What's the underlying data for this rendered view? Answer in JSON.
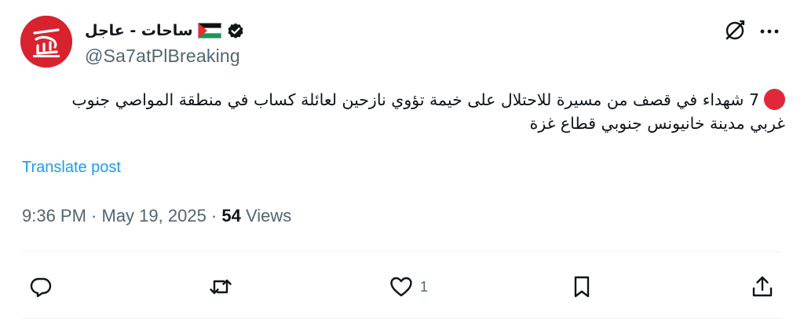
{
  "author": {
    "display_name": "ساحات - عاجل",
    "handle": "@Sa7atPlBreaking",
    "avatar_icon": "sa7at-logo",
    "flag_icon": "palestine-flag",
    "verified_icon": "verified-badge"
  },
  "header_actions": {
    "grok_icon": "grok-icon",
    "more_icon": "more-icon"
  },
  "tweet": {
    "bullet_icon": "red-circle",
    "text": "7 شهداء في قصف من مسيرة للاحتلال على خيمة تؤوي نازحين لعائلة كساب في منطقة المواصي جنوب غربي مدينة خانيونس جنوبي قطاع غزة",
    "translate_label": "Translate post"
  },
  "meta": {
    "time": "9:36 PM",
    "separator": " · ",
    "date": "May 19, 2025",
    "separator2": " · ",
    "views_count": "54",
    "views_label": " Views"
  },
  "actions": {
    "reply_count": "",
    "repost_count": "",
    "like_count": "1",
    "bookmark_count": "",
    "share_label": ""
  },
  "colors": {
    "accent": "#1d9bf0",
    "secondary_text": "#536471",
    "brand_red": "#d8232f"
  }
}
